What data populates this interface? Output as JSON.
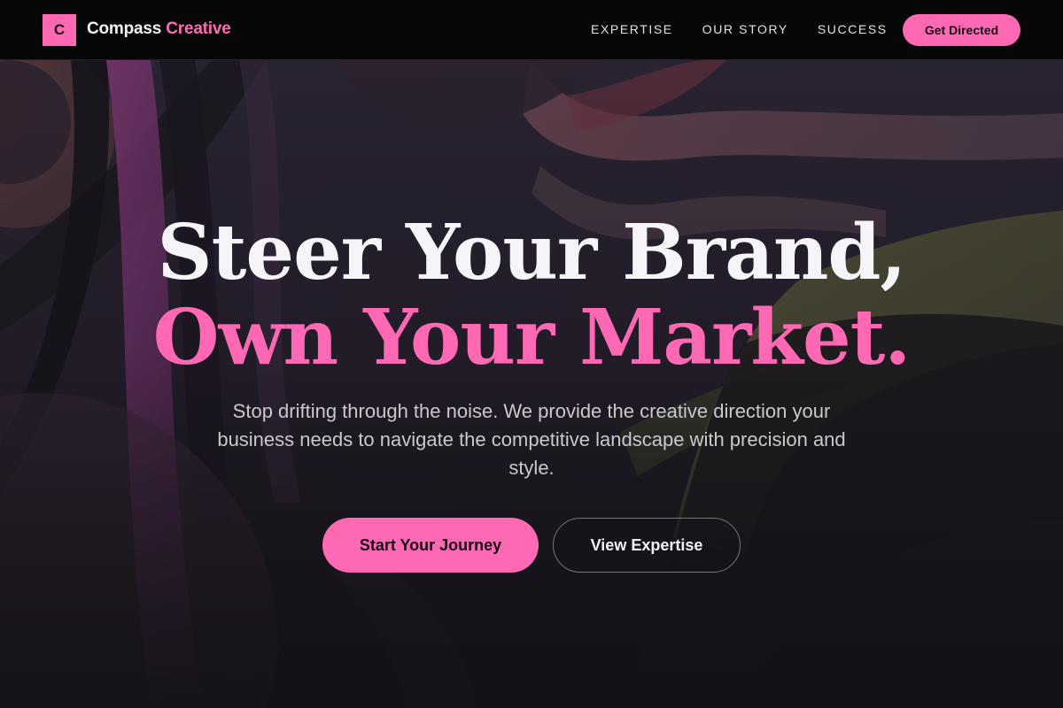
{
  "nav": {
    "logo_letter": "C",
    "brand_part1": "Compass",
    "brand_part2": "Creative",
    "links": [
      "EXPERTISE",
      "OUR STORY",
      "SUCCESS"
    ],
    "cta_label": "Get Directed"
  },
  "hero": {
    "headline_line1": "Steer Your Brand,",
    "headline_line2": "Own Your Market.",
    "subtext": "Stop drifting through the noise. We provide the creative direction your business needs to navigate the competitive landscape with precision and style.",
    "primary_button": "Start Your Journey",
    "secondary_button": "View Expertise"
  },
  "colors": {
    "accent": "#ff69b4",
    "nav_background": "#070708",
    "page_background": "#16141a",
    "heading_text": "#f6f4f8"
  }
}
